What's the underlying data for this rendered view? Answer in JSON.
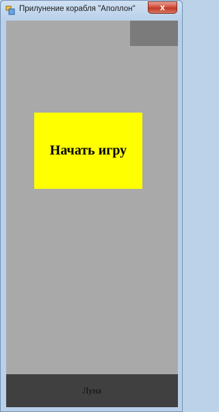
{
  "window": {
    "title": "Прилунение корабля \"Аполлон\"",
    "close_glyph": "x",
    "app_icon": "window-app-icon"
  },
  "game": {
    "start_button_label": "Начать игру",
    "bottom_label": "Луна"
  },
  "colors": {
    "client_bg": "#a9a9a9",
    "corner_box": "#7b7b7b",
    "start_button": "#ffff00",
    "bottom_bar": "#404040"
  }
}
